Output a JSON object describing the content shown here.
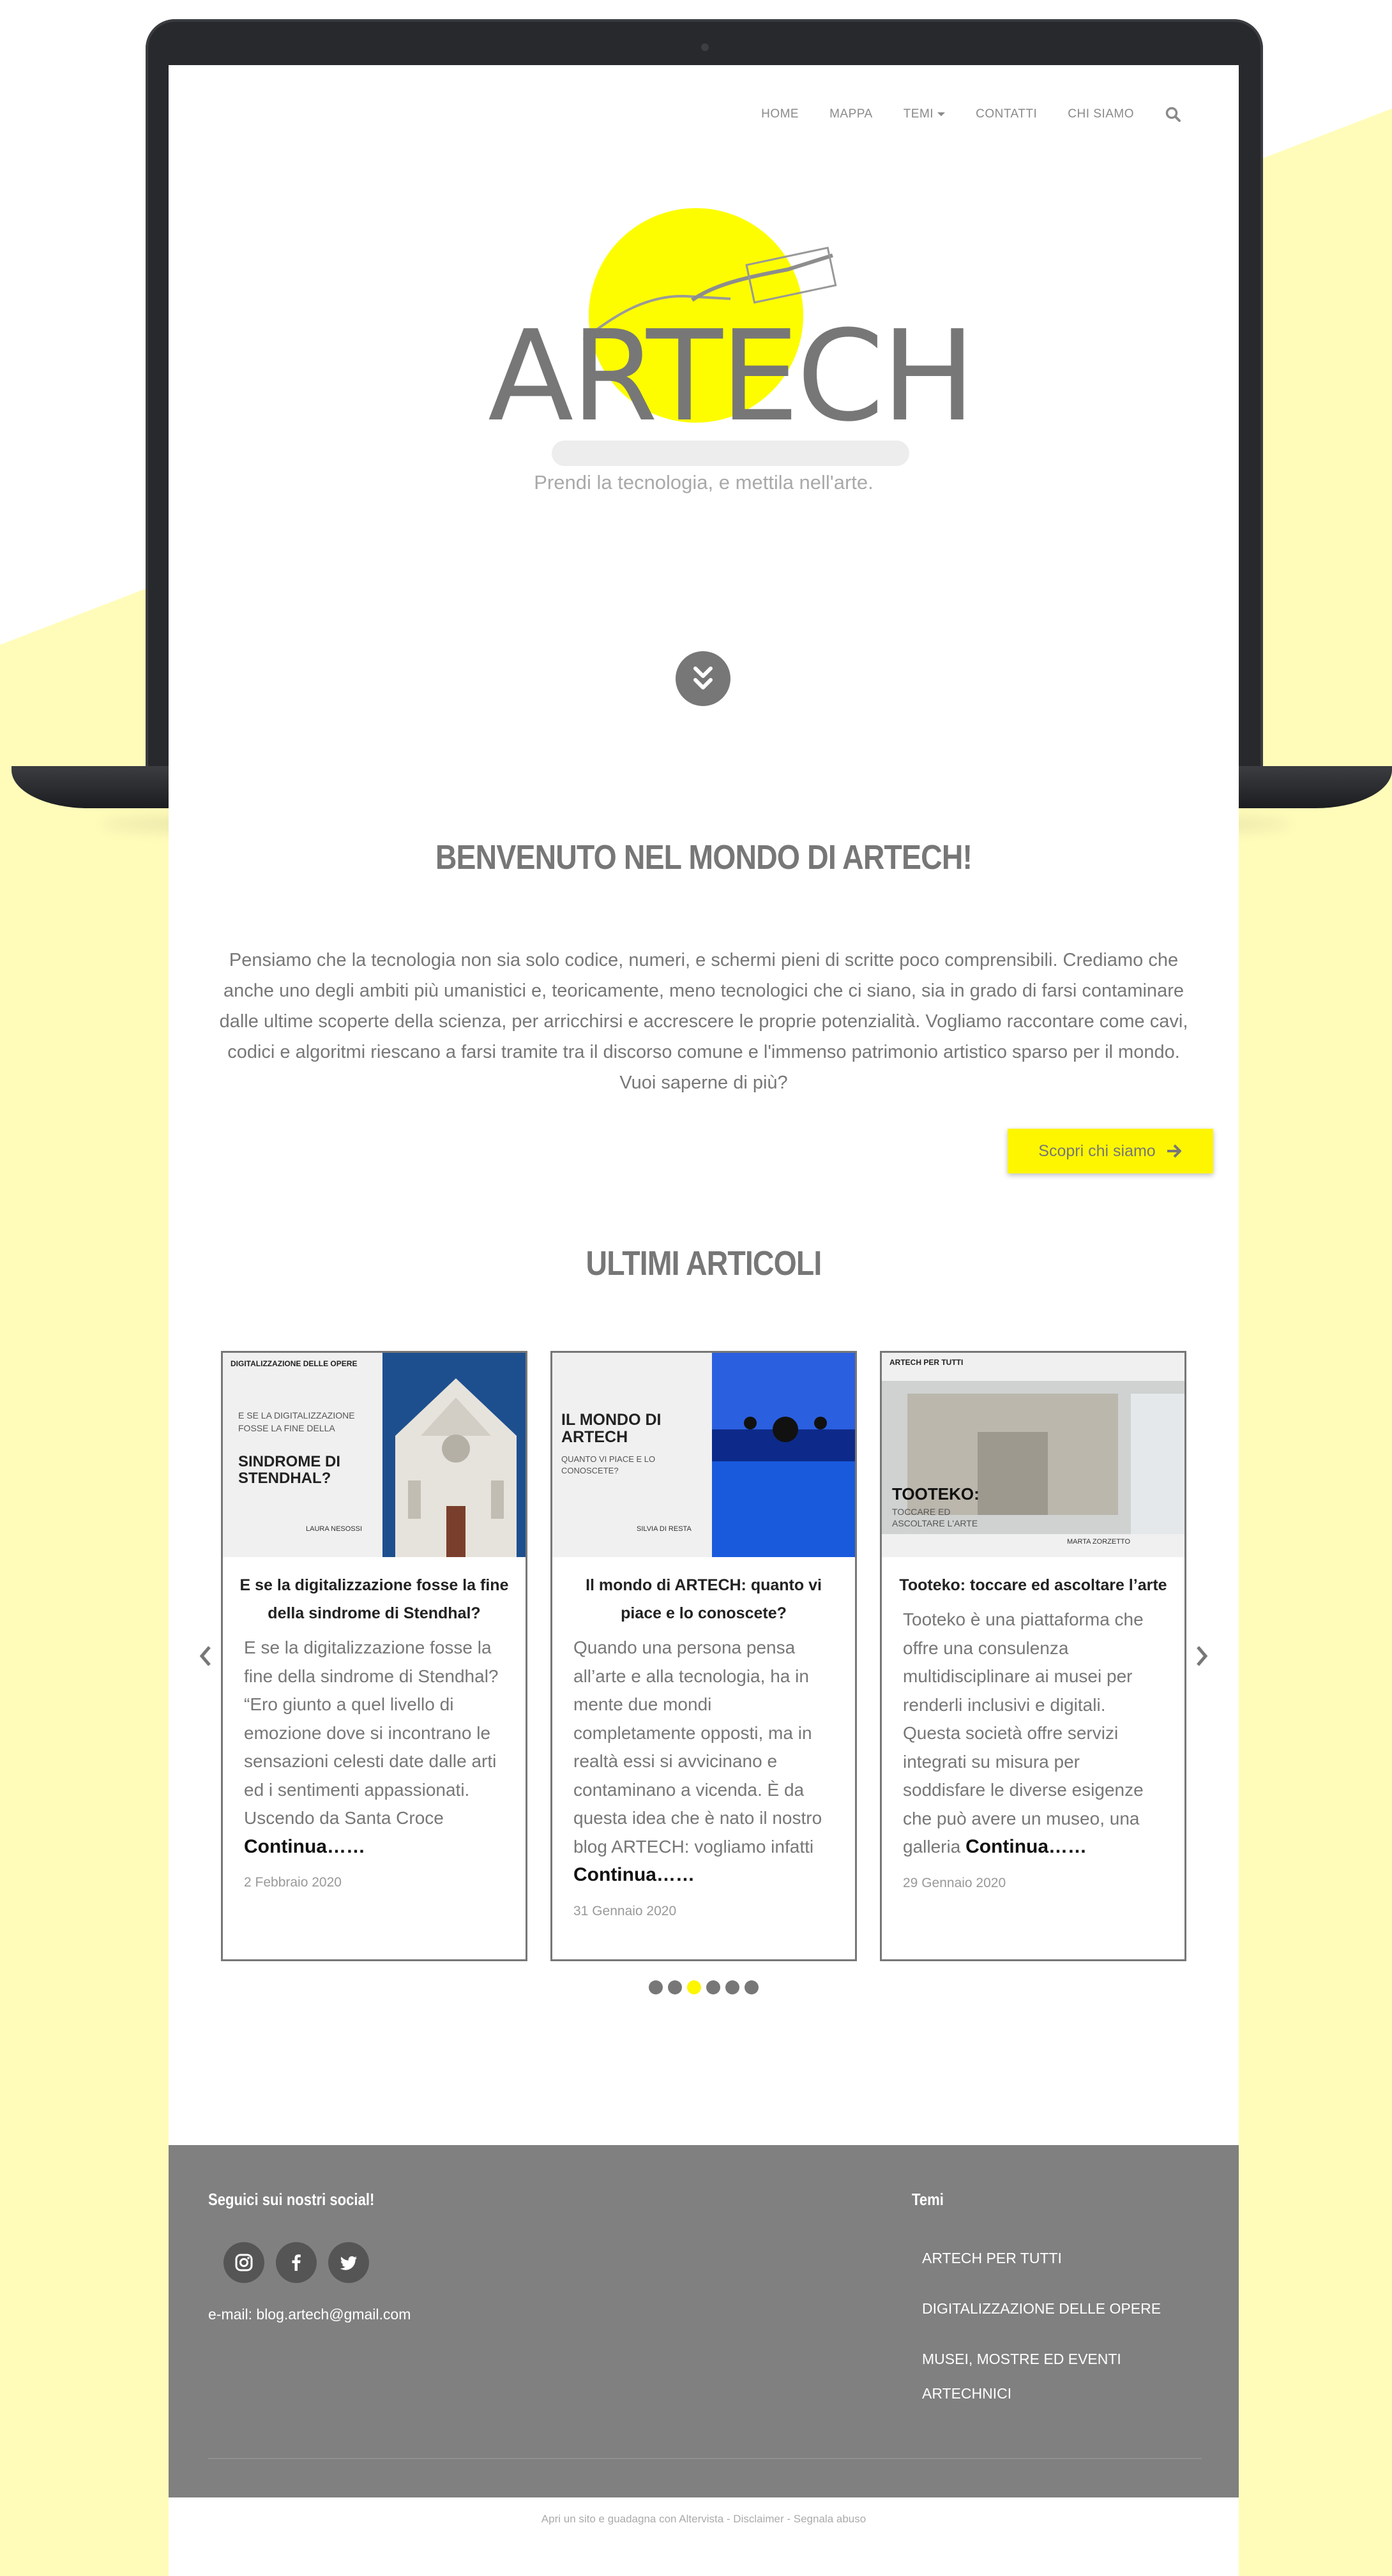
{
  "nav": {
    "items": [
      "HOME",
      "MAPPA",
      "TEMI",
      "CONTATTI",
      "CHI SIAMO"
    ],
    "search_icon": "search-icon"
  },
  "hero": {
    "logo_text": "ARTECH",
    "tagline": "Prendi la tecnologia, e mettila nell'arte.",
    "scroll_icon": "double-chevron-down-icon"
  },
  "welcome": {
    "title": "BENVENUTO NEL MONDO DI ARTECH!",
    "text": "Pensiamo che la tecnologia non sia solo codice, numeri, e schermi pieni di scritte poco comprensibili. Crediamo che anche uno degli ambiti più umanistici e, teoricamente, meno tecnologici che ci siano, sia in grado di farsi contaminare dalle ultime scoperte della scienza, per arricchirsi e accrescere le proprie potenzialità. Vogliamo raccontare come cavi, codici e algoritmi riescano a farsi tramite tra il discorso comune e l'immenso patrimonio artistico sparso per il mondo. Vuoi saperne di più?",
    "cta": "Scopri chi siamo"
  },
  "articles": {
    "title": "ULTIMI ARTICOLI",
    "cards": [
      {
        "thumb_tag": "DIGITALIZZAZIONE DELLE OPERE",
        "thumb_small": "E SE LA DIGITALIZZAZIONE FOSSE LA FINE DELLA",
        "thumb_big": "SINDROME DI STENDHAL?",
        "thumb_author": "LAURA NESOSSI",
        "title": "E se la digitalizzazione fosse la fine della sindrome di Stendhal?",
        "excerpt": "E se la digitalizzazione fosse la fine della sindrome di Stendhal? “Ero giunto a quel livello di emozione dove si incontrano le sensazioni celesti date dalle arti ed i sentimenti appassionati. Uscendo da Santa Croce",
        "more": "Continua……",
        "date": "2 Febbraio 2020"
      },
      {
        "thumb_big": "IL MONDO DI ARTECH",
        "thumb_small": "QUANTO VI PIACE E LO CONOSCETE?",
        "thumb_author": "SILVIA DI RESTA",
        "title": "Il mondo di ARTECH: quanto vi piace e lo conoscete?",
        "excerpt": "Quando una persona pensa all’arte e alla tecnologia, ha in mente due mondi completamente opposti, ma in realtà essi si avvicinano e contaminano a vicenda. È da questa idea che è nato il nostro blog ARTECH: vogliamo infatti",
        "more": "Continua……",
        "date": "31 Gennaio 2020"
      },
      {
        "thumb_tag": "ARTECH PER TUTTI",
        "thumb_big": "TOOTEKO:",
        "thumb_small": "TOCCARE ED ASCOLTARE L'ARTE",
        "thumb_author": "MARTA ZORZETTO",
        "title": "Tooteko: toccare ed ascoltare l’arte",
        "excerpt": "Tooteko è una piattaforma che offre una consulenza multidisciplinare ai musei per renderli inclusivi e digitali. Questa società offre servizi integrati su misura per soddisfare le diverse esigenze che può avere un museo, una galleria",
        "more": "Continua……",
        "date": "29 Gennaio 2020"
      }
    ],
    "dot_count": 6,
    "active_dot": 2
  },
  "footer": {
    "social_title": "Seguici sui nostri social!",
    "social_icons": [
      "instagram-icon",
      "facebook-icon",
      "twitter-icon"
    ],
    "email": "e-mail: blog.artech@gmail.com",
    "themes_title": "Temi",
    "themes": [
      "ARTECH PER TUTTI",
      "DIGITALIZZAZIONE DELLE OPERE",
      "MUSEI, MOSTRE ED EVENTI",
      "ARTECHNICI"
    ],
    "bottom_text": "Apri un sito e guadagna con Altervista - Disclaimer - Segnala abuso"
  },
  "colors": {
    "accent_yellow": "#fdf600",
    "page_bg": "#fffcba",
    "footer_bg": "#808080",
    "text_gray": "#777777"
  }
}
